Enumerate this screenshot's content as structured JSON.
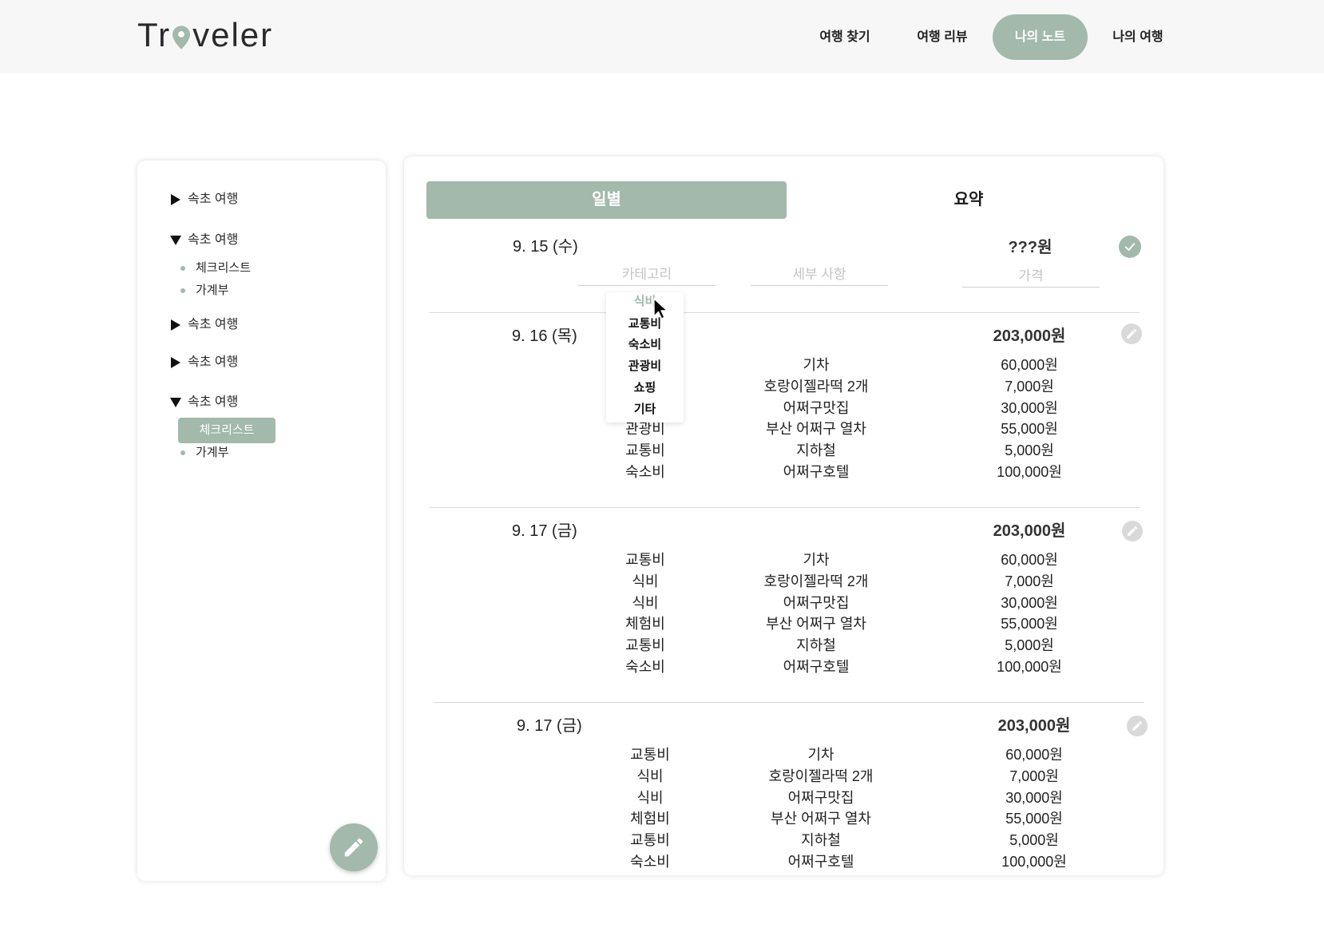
{
  "colors": {
    "accent": "#a2b9ac",
    "header_bg": "#f7f7f7",
    "divider": "#dcdcdc",
    "edit_icon_bg": "#d9d9d9"
  },
  "header": {
    "logo": {
      "text_before_pin": "Tr",
      "text_after_pin": "veler",
      "pin_icon": "map-pin-icon"
    },
    "nav": [
      {
        "label": "여행 찾기",
        "active": false
      },
      {
        "label": "여행 리뷰",
        "active": false
      },
      {
        "label": "나의 노트",
        "active": true
      },
      {
        "label": "나의 여행",
        "active": false
      }
    ]
  },
  "sidebar": {
    "trips": [
      {
        "label": "속초 여행",
        "expanded": false,
        "arrow_icon": "triangle-right-icon",
        "children": []
      },
      {
        "label": "속초 여행",
        "expanded": true,
        "arrow_icon": "triangle-down-icon",
        "children": [
          {
            "label": "체크리스트",
            "active": false
          },
          {
            "label": "가계부",
            "active": false
          }
        ]
      },
      {
        "label": "속초 여행",
        "expanded": false,
        "arrow_icon": "triangle-right-icon",
        "children": []
      },
      {
        "label": "속초 여행",
        "expanded": false,
        "arrow_icon": "triangle-right-icon",
        "children": []
      },
      {
        "label": "속초 여행",
        "expanded": true,
        "arrow_icon": "triangle-down-icon",
        "children": [
          {
            "label": "체크리스트",
            "active": true
          },
          {
            "label": "가계부",
            "active": false
          }
        ]
      }
    ],
    "fab_icon": "pencil-icon"
  },
  "main": {
    "tabs": [
      {
        "label": "일별",
        "active": true
      },
      {
        "label": "요약",
        "active": false
      }
    ],
    "new_day": {
      "date": "9. 15 (수)",
      "total": "???원",
      "confirm_icon": "check-icon",
      "fields": {
        "category": {
          "value": "",
          "placeholder": "카테고리"
        },
        "detail": {
          "value": "",
          "placeholder": "세부 사항"
        },
        "price": {
          "value": "",
          "placeholder": "가격"
        }
      },
      "category_dropdown": {
        "options": [
          "식비",
          "교통비",
          "숙소비",
          "관광비",
          "쇼핑",
          "기타"
        ],
        "highlighted_index": 0
      },
      "pointer_icon": "mouse-pointer-icon"
    },
    "days": [
      {
        "date": "9. 16 (목)",
        "total": "203,000원",
        "edit_icon": "pencil-icon",
        "items": [
          {
            "category": "",
            "detail": "기차",
            "price": "60,000원"
          },
          {
            "category": "",
            "detail": "호랑이젤라떡 2개",
            "price": "7,000원"
          },
          {
            "category": "",
            "detail": "어쩌구맛집",
            "price": "30,000원"
          },
          {
            "category": "관광비",
            "detail": "부산 어쩌구 열차",
            "price": "55,000원"
          },
          {
            "category": "교통비",
            "detail": "지하철",
            "price": "5,000원"
          },
          {
            "category": "숙소비",
            "detail": "어쩌구호텔",
            "price": "100,000원"
          }
        ]
      },
      {
        "date": "9. 17 (금)",
        "total": "203,000원",
        "edit_icon": "pencil-icon",
        "items": [
          {
            "category": "교통비",
            "detail": "기차",
            "price": "60,000원"
          },
          {
            "category": "식비",
            "detail": "호랑이젤라떡 2개",
            "price": "7,000원"
          },
          {
            "category": "식비",
            "detail": "어쩌구맛집",
            "price": "30,000원"
          },
          {
            "category": "체험비",
            "detail": "부산 어쩌구 열차",
            "price": "55,000원"
          },
          {
            "category": "교통비",
            "detail": "지하철",
            "price": "5,000원"
          },
          {
            "category": "숙소비",
            "detail": "어쩌구호텔",
            "price": "100,000원"
          }
        ]
      },
      {
        "date": "9. 17 (금)",
        "total": "203,000원",
        "edit_icon": "pencil-icon",
        "items": [
          {
            "category": "교통비",
            "detail": "기차",
            "price": "60,000원"
          },
          {
            "category": "식비",
            "detail": "호랑이젤라떡 2개",
            "price": "7,000원"
          },
          {
            "category": "식비",
            "detail": "어쩌구맛집",
            "price": "30,000원"
          },
          {
            "category": "체험비",
            "detail": "부산 어쩌구 열차",
            "price": "55,000원"
          },
          {
            "category": "교통비",
            "detail": "지하철",
            "price": "5,000원"
          },
          {
            "category": "숙소비",
            "detail": "어쩌구호텔",
            "price": "100,000원"
          }
        ]
      }
    ]
  }
}
